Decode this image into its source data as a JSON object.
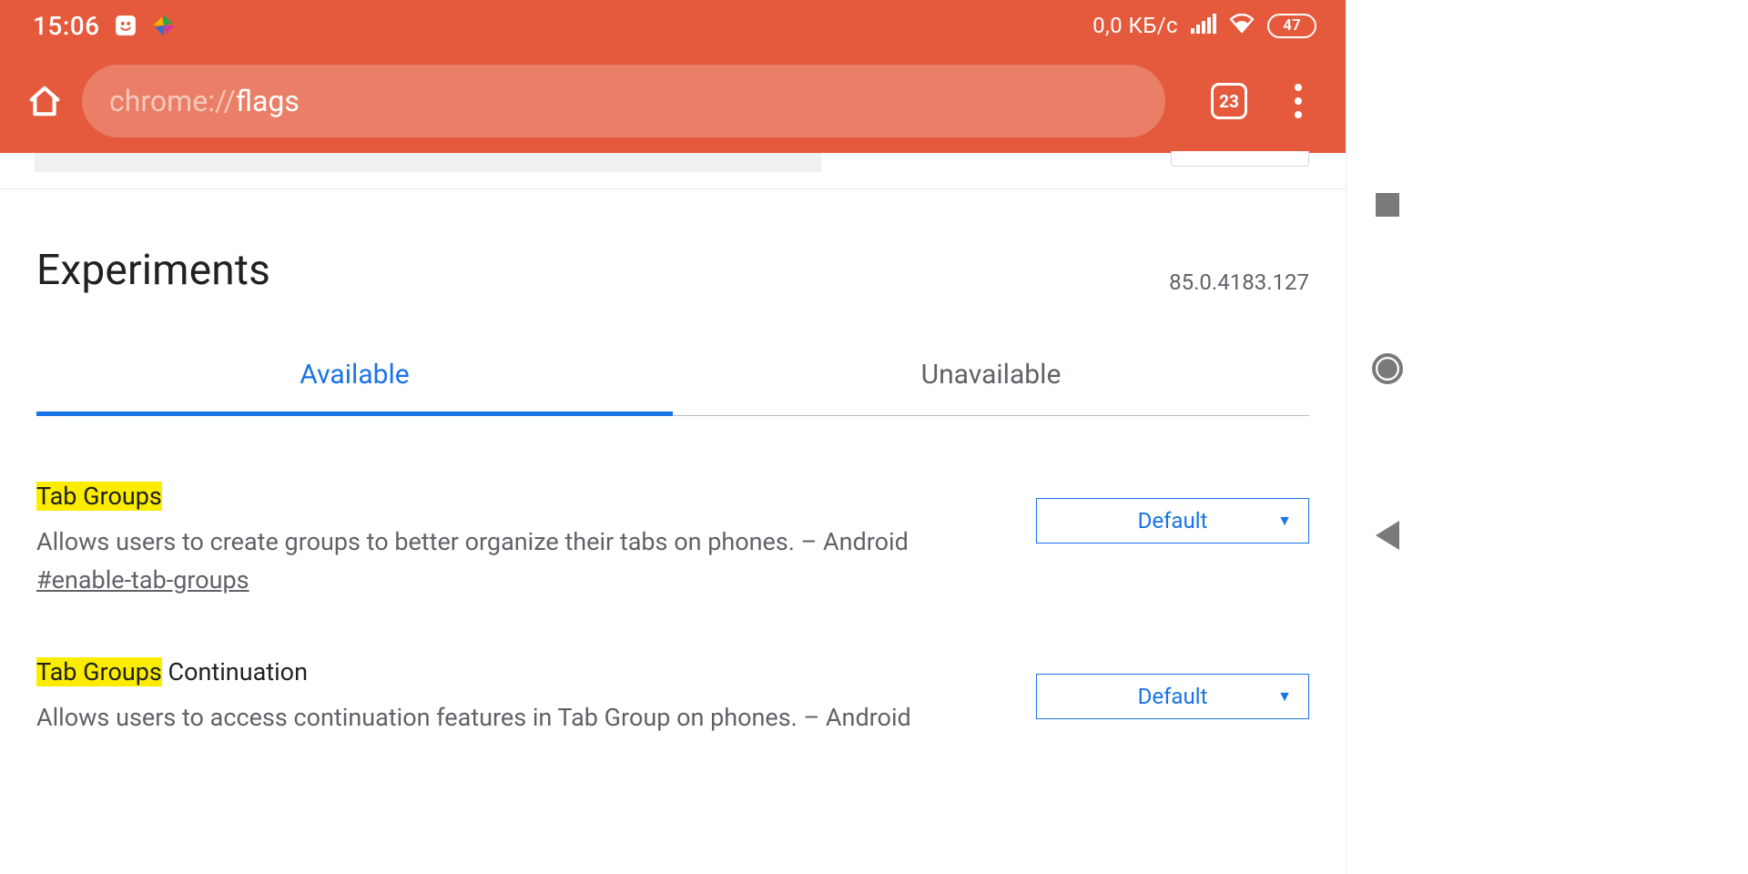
{
  "statusbar": {
    "time": "15:06",
    "net_speed": "0,0 КБ/с",
    "battery": "47"
  },
  "toolbar": {
    "url_proto": "chrome://",
    "url_path": "flags",
    "tab_count": "23"
  },
  "page": {
    "title": "Experiments",
    "version": "85.0.4183.127"
  },
  "tabs": {
    "available": "Available",
    "unavailable": "Unavailable"
  },
  "flags": [
    {
      "title_hl": "Tab Groups",
      "title_rest": "",
      "desc": "Allows users to create groups to better organize their tabs on phones. – Android",
      "anchor": "#enable-tab-groups",
      "select_value": "Default"
    },
    {
      "title_hl": "Tab Groups",
      "title_rest": " Continuation",
      "desc": "Allows users to access continuation features in Tab Group on phones. – Android",
      "anchor": "",
      "select_value": "Default"
    }
  ]
}
